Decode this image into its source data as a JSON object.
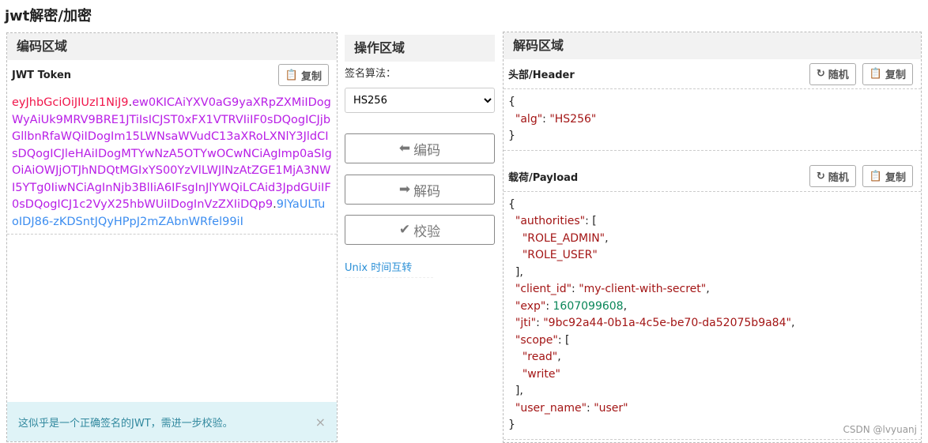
{
  "page_title": "jwt解密/加密",
  "encode": {
    "title": "编码区域",
    "token_label": "JWT Token",
    "copy": "复制",
    "token_header": "eyJhbGciOiJIUzI1NiJ9",
    "token_payload": "ew0KICAiYXV0aG9yaXRpZXMiIDogWyAiUk9MRV9BRE1JTiIsICJST0xFX1VTRVIiIF0sDQogICJjbGllbnRfaWQiIDogIm15LWNsaWVudC13aXRoLXNlY3JldCIsDQogICJleHAiIDogMTYwNzA5OTYwOCwNCiAgImp0aSIgOiAiOWJjOTJhNDQtMGIxYS00YzVlLWJlNzAtZGE1MjA3NWI5YTg0IiwNCiAgInNjb3BlIiA6IFsgInJlYWQiLCAid3JpdGUiIF0sDQogICJ1c2VyX25hbWUiIDogInVzZXIiDQp9",
    "token_signature": "9lYaULTuoIDJ86-zKDSntJQyHPpJ2mZAbnWRfel99iI",
    "alert": "这似乎是一个正确签名的JWT，需进一步校验。",
    "alert_close": "×"
  },
  "ops": {
    "title": "操作区域",
    "algo_label": "签名算法：",
    "algo_selected": "HS256",
    "encode": "编码",
    "decode": "解码",
    "verify": "校验",
    "unix_link": "Unix 时间互转"
  },
  "decode": {
    "title": "解码区域",
    "header_label": "头部/Header",
    "payload_label": "载荷/Payload",
    "random": "随机",
    "copy": "复制",
    "header_lines": [
      [
        [
          "p",
          "{"
        ]
      ],
      [
        [
          "p",
          "  "
        ],
        [
          "k",
          "\"alg\""
        ],
        [
          "p",
          ": "
        ],
        [
          "s",
          "\"HS256\""
        ]
      ],
      [
        [
          "p",
          "}"
        ]
      ]
    ],
    "payload_lines": [
      [
        [
          "p",
          "{"
        ]
      ],
      [
        [
          "p",
          "  "
        ],
        [
          "k",
          "\"authorities\""
        ],
        [
          "p",
          ": ["
        ]
      ],
      [
        [
          "p",
          "    "
        ],
        [
          "s",
          "\"ROLE_ADMIN\""
        ],
        [
          "p",
          ","
        ]
      ],
      [
        [
          "p",
          "    "
        ],
        [
          "s",
          "\"ROLE_USER\""
        ]
      ],
      [
        [
          "p",
          "  ],"
        ]
      ],
      [
        [
          "p",
          "  "
        ],
        [
          "k",
          "\"client_id\""
        ],
        [
          "p",
          ": "
        ],
        [
          "s",
          "\"my-client-with-secret\""
        ],
        [
          "p",
          ","
        ]
      ],
      [
        [
          "p",
          "  "
        ],
        [
          "k",
          "\"exp\""
        ],
        [
          "p",
          ": "
        ],
        [
          "n",
          "1607099608"
        ],
        [
          "p",
          ","
        ]
      ],
      [
        [
          "p",
          "  "
        ],
        [
          "k",
          "\"jti\""
        ],
        [
          "p",
          ": "
        ],
        [
          "s",
          "\"9bc92a44-0b1a-4c5e-be70-da52075b9a84\""
        ],
        [
          "p",
          ","
        ]
      ],
      [
        [
          "p",
          "  "
        ],
        [
          "k",
          "\"scope\""
        ],
        [
          "p",
          ": ["
        ]
      ],
      [
        [
          "p",
          "    "
        ],
        [
          "s",
          "\"read\""
        ],
        [
          "p",
          ","
        ]
      ],
      [
        [
          "p",
          "    "
        ],
        [
          "s",
          "\"write\""
        ]
      ],
      [
        [
          "p",
          "  ],"
        ]
      ],
      [
        [
          "p",
          "  "
        ],
        [
          "k",
          "\"user_name\""
        ],
        [
          "p",
          ": "
        ],
        [
          "s",
          "\"user\""
        ]
      ],
      [
        [
          "p",
          "}"
        ]
      ]
    ]
  },
  "watermark": "CSDN @lvyuanj"
}
